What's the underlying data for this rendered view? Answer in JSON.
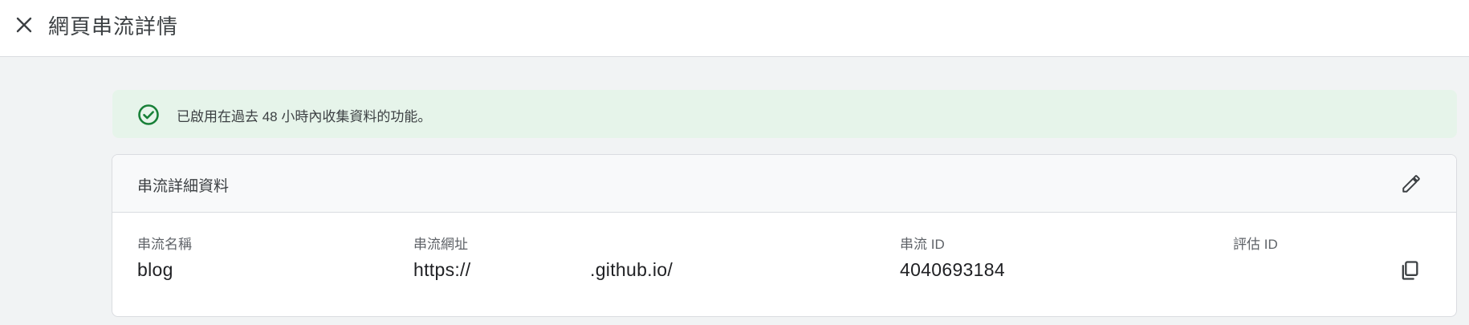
{
  "header": {
    "title": "網頁串流詳情"
  },
  "banner": {
    "message": "已啟用在過去 48 小時內收集資料的功能。",
    "accent_color": "#188038",
    "background_color": "#e6f4ea"
  },
  "details": {
    "title": "串流詳細資料",
    "fields": [
      {
        "label": "串流名稱",
        "value": "blog"
      },
      {
        "label": "串流網址",
        "value_prefix": "https://",
        "value_suffix": ".github.io/"
      },
      {
        "label": "串流 ID",
        "value": "4040693184"
      },
      {
        "label": "評估 ID",
        "value": ""
      }
    ]
  },
  "icons": {
    "close": "close-icon",
    "check": "check-circle-icon",
    "edit": "pencil-icon",
    "copy": "copy-icon"
  }
}
